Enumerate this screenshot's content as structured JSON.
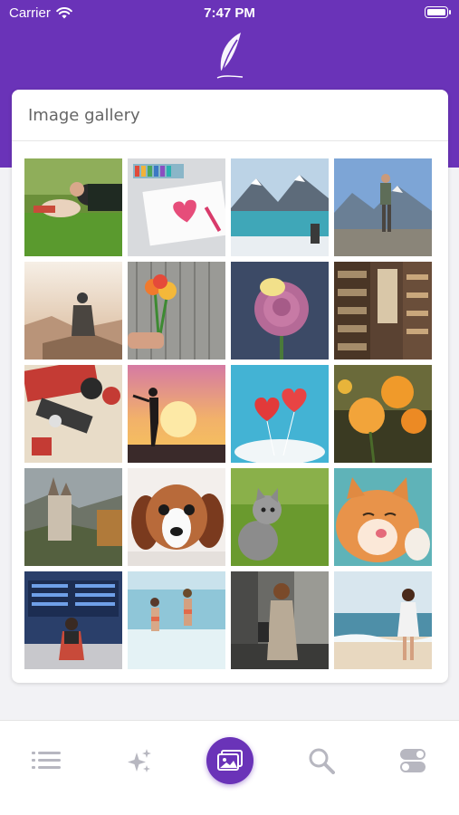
{
  "status_bar": {
    "carrier": "Carrier",
    "time": "7:47 PM"
  },
  "gallery": {
    "title": "Image gallery",
    "images": [
      "couple-in-grass",
      "heart-drawing-and-crayons",
      "mountain-lake",
      "hiker-on-peak",
      "person-on-cliff-sunrise",
      "flowers-in-hand",
      "pink-rose",
      "bookshop",
      "retro-camera",
      "silhouette-at-sunset",
      "red-heart-balloons",
      "orange-flowers",
      "castle-in-valley",
      "puppy-lying",
      "kitten-on-grass",
      "cat-licking",
      "airport-departure-board",
      "women-running-in-sea",
      "woman-on-street",
      "woman-on-beach"
    ]
  },
  "tabs": [
    {
      "icon": "list-icon",
      "active": false
    },
    {
      "icon": "sparkles-icon",
      "active": false
    },
    {
      "icon": "gallery-icon",
      "active": true
    },
    {
      "icon": "search-icon",
      "active": false
    },
    {
      "icon": "toggles-icon",
      "active": false
    }
  ],
  "colors": {
    "brand": "#6a33b8",
    "tab_icon": "#b7b7c0"
  }
}
